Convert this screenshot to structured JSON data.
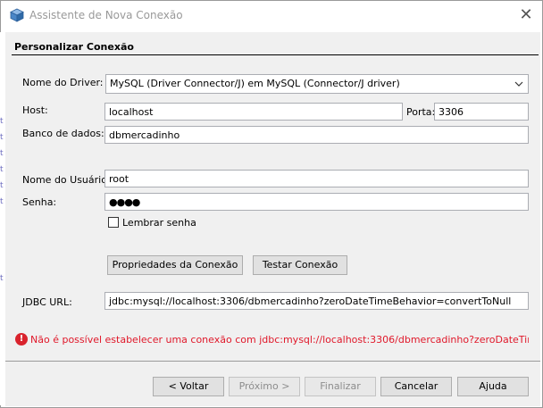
{
  "window": {
    "title": "Assistente de Nova Conexão",
    "close_glyph": "✕",
    "app_icon": "netbeans-cube-icon"
  },
  "panel": {
    "title": "Personalizar Conexão"
  },
  "form": {
    "driver_label": "Nome do Driver:",
    "driver_value": "MySQL (Driver Connector/J) em MySQL (Connector/J driver)",
    "host_label": "Host:",
    "host_value": "localhost",
    "port_label": "Porta:",
    "port_value": "3306",
    "database_label": "Banco de dados:",
    "database_value": "dbmercadinho",
    "user_label": "Nome do Usuário:",
    "user_value": "root",
    "password_label": "Senha:",
    "password_value": "●●●●",
    "remember_label": "Lembrar senha",
    "remember_checked": false,
    "jdbc_label": "JDBC URL:",
    "jdbc_value": "jdbc:mysql://localhost:3306/dbmercadinho?zeroDateTimeBehavior=convertToNull"
  },
  "actions": {
    "properties_label": "Propriedades da Conexão",
    "test_label": "Testar Conexão"
  },
  "error": {
    "icon": "error-icon",
    "message": "Não é possível estabelecer uma conexão com jdbc:mysql://localhost:3306/dbmercadinho?zeroDateTimeBehavior=convertToNull usando com.mysql.jdbc.Driver"
  },
  "footer": {
    "back_label": "< Voltar",
    "next_label": "Próximo >",
    "finish_label": "Finalizar",
    "cancel_label": "Cancelar",
    "help_label": "Ajuda"
  },
  "colors": {
    "error_red": "#e0182a",
    "dialog_bg": "#f0f0f0",
    "title_gray": "#999999"
  }
}
